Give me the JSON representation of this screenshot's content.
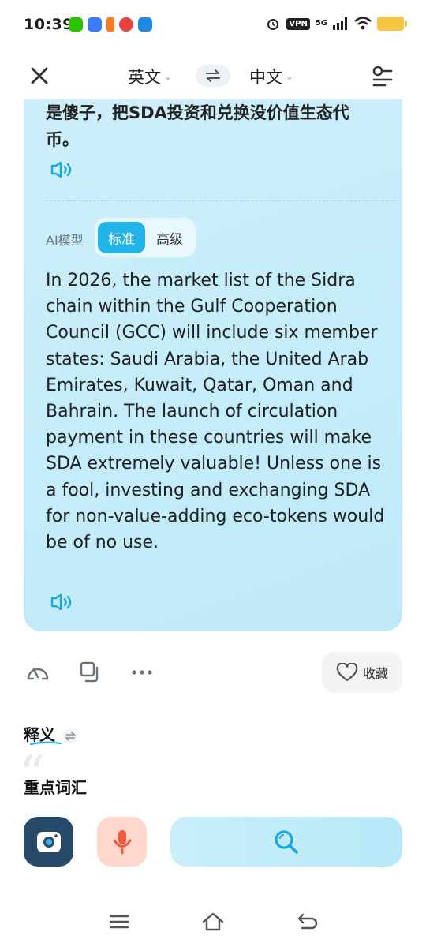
{
  "status_bar": {
    "time": "10:39",
    "vpn": "VPN",
    "network": "5G"
  },
  "header": {
    "source_lang": "英文",
    "target_lang": "中文"
  },
  "card": {
    "chinese_translation": "是傻子，把SDA投资和兑换没价值生态代币。",
    "ai_model_label": "AI模型",
    "model_standard": "标准",
    "model_advanced": "高级",
    "english_text": "In 2026, the market list of the Sidra chain within the Gulf Cooperation Council (GCC) will include six member states: Saudi Arabia, the United Arab Emirates, Kuwait, Qatar, Oman and Bahrain. The launch of circulation payment in these countries will make SDA extremely valuable! Unless one is a fool, investing and exchanging SDA for non-value-adding eco-tokens would be of no use."
  },
  "actions": {
    "favorite_label": "收藏"
  },
  "sections": {
    "definition": "释义",
    "key_vocab": "重点词汇"
  },
  "colors": {
    "accent": "#22b4e6",
    "card_bg": "#c4ecfa",
    "camera_bg": "#274a6b",
    "mic_bg": "#ffd7cc"
  },
  "icons": {
    "close": "close-icon",
    "swap": "swap-icon",
    "settings": "settings-icon",
    "speaker": "speaker-icon",
    "rate": "gauge-icon",
    "copy": "copy-icon",
    "more": "more-icon",
    "heart": "heart-icon",
    "camera": "camera-icon",
    "mic": "microphone-icon",
    "search": "search-icon"
  }
}
